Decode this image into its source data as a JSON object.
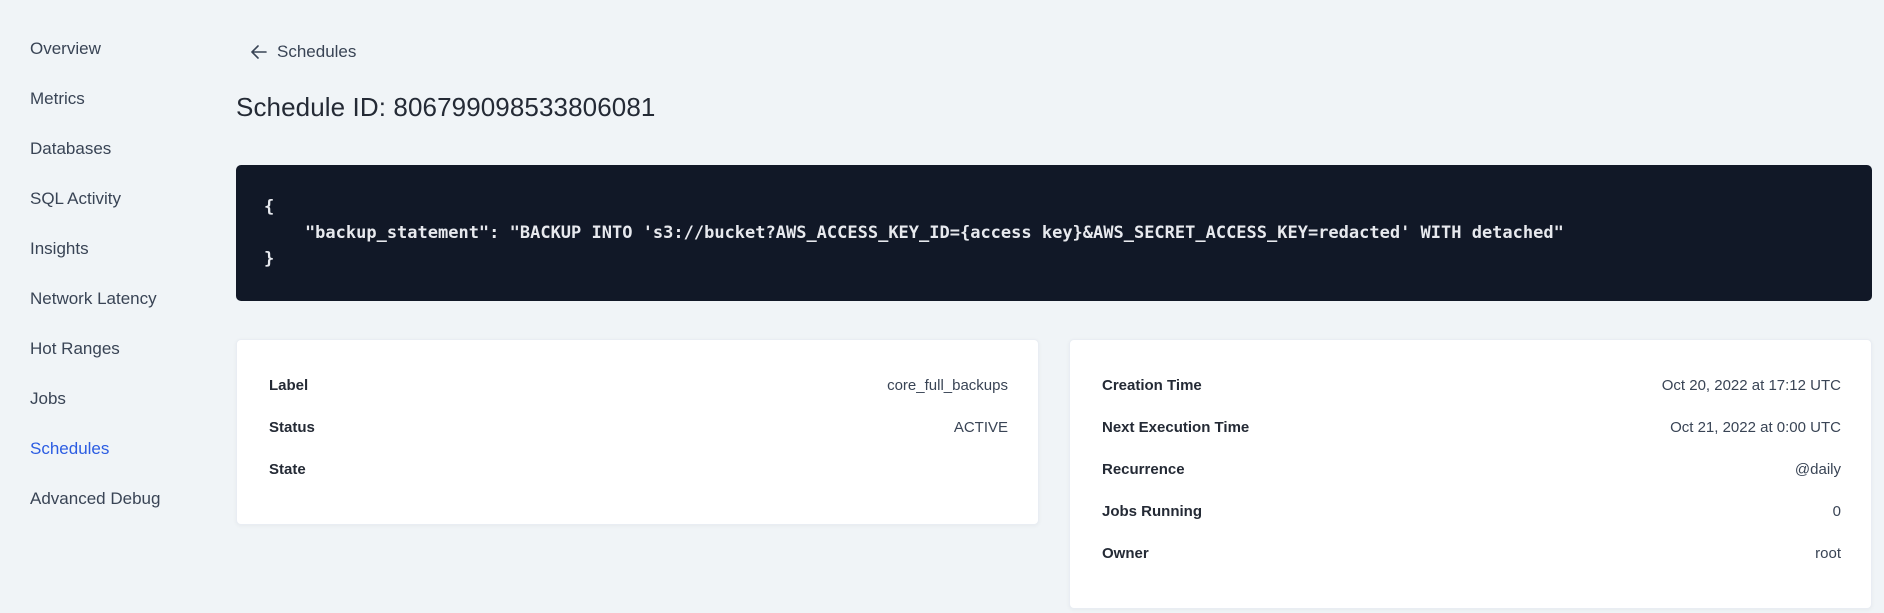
{
  "sidebar": {
    "items": [
      {
        "label": "Overview",
        "active": false
      },
      {
        "label": "Metrics",
        "active": false
      },
      {
        "label": "Databases",
        "active": false
      },
      {
        "label": "SQL Activity",
        "active": false
      },
      {
        "label": "Insights",
        "active": false
      },
      {
        "label": "Network Latency",
        "active": false
      },
      {
        "label": "Hot Ranges",
        "active": false
      },
      {
        "label": "Jobs",
        "active": false
      },
      {
        "label": "Schedules",
        "active": true
      },
      {
        "label": "Advanced Debug",
        "active": false
      }
    ]
  },
  "header": {
    "back_label": "Schedules",
    "back_icon": "arrow-left-icon",
    "title": "Schedule ID: 806799098533806081"
  },
  "code_block": {
    "lines": [
      "{",
      "    \"backup_statement\": \"BACKUP INTO 's3://bucket?AWS_ACCESS_KEY_ID={access key}&AWS_SECRET_ACCESS_KEY=redacted' WITH detached\"",
      "}"
    ]
  },
  "cards": {
    "left": {
      "rows": [
        {
          "label": "Label",
          "value": "core_full_backups"
        },
        {
          "label": "Status",
          "value": "ACTIVE"
        },
        {
          "label": "State",
          "value": ""
        }
      ]
    },
    "right": {
      "rows": [
        {
          "label": "Creation Time",
          "value": "Oct 20, 2022 at 17:12 UTC"
        },
        {
          "label": "Next Execution Time",
          "value": "Oct 21, 2022 at 0:00 UTC"
        },
        {
          "label": "Recurrence",
          "value": "@daily"
        },
        {
          "label": "Jobs Running",
          "value": "0"
        },
        {
          "label": "Owner",
          "value": "root"
        }
      ]
    }
  },
  "colors": {
    "page_background": "#f0f4f7",
    "card_background": "#ffffff",
    "code_background": "#111827",
    "code_text": "#e7e9ee",
    "text_primary": "#242a35",
    "text_secondary": "#394455",
    "accent_link": "#2b5ce2"
  }
}
